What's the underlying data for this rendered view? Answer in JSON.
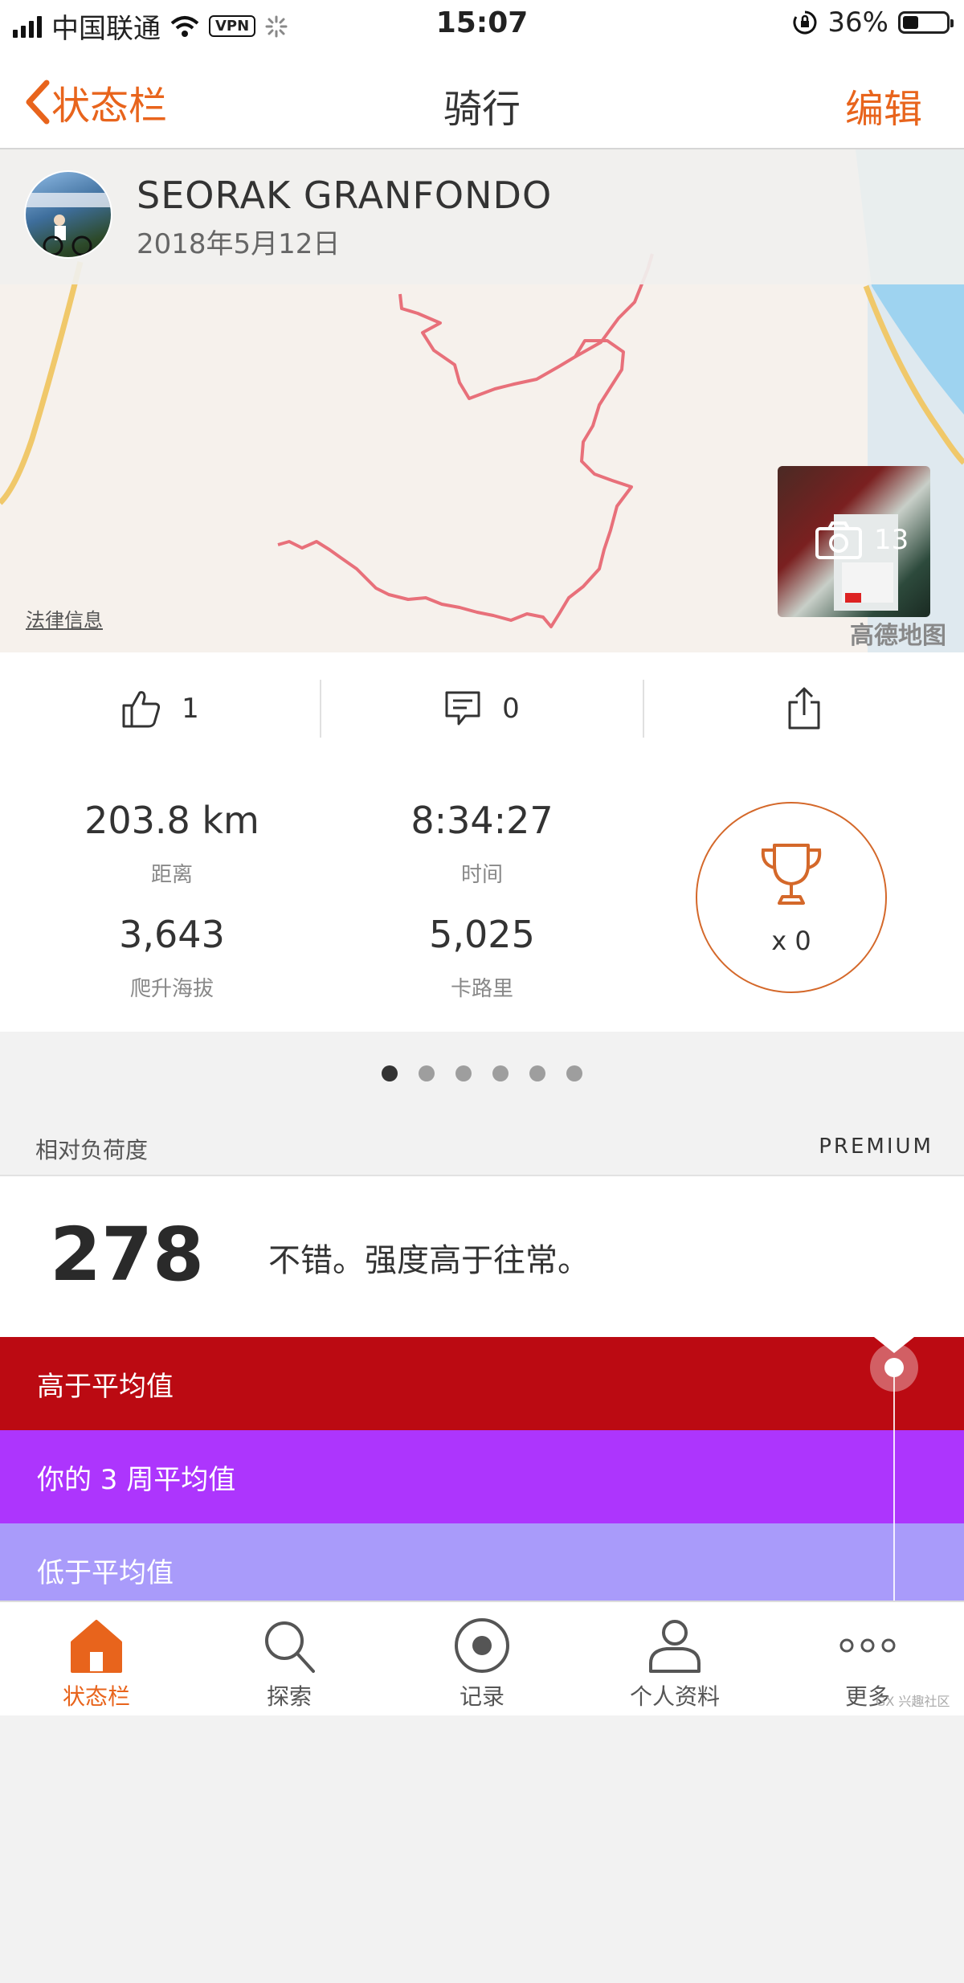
{
  "status_bar": {
    "carrier": "中国联通",
    "vpn": "VPN",
    "time": "15:07",
    "battery": "36%",
    "battery_level": 0.36
  },
  "nav": {
    "back_label": "状态栏",
    "title": "骑行",
    "edit_label": "编辑"
  },
  "activity": {
    "name": "SEORAK GRANFONDO",
    "date": "2018年5月12日",
    "photo_count": "13",
    "map_legal": "法律信息",
    "map_provider": "高德地图"
  },
  "actions": {
    "kudos_count": "1",
    "comment_count": "0"
  },
  "stats": [
    {
      "value": "203.8 km",
      "label": "距离"
    },
    {
      "value": "8:34:27",
      "label": "时间"
    },
    {
      "value": "3,643",
      "label": "爬升海拔"
    },
    {
      "value": "5,025",
      "label": "卡路里"
    }
  ],
  "achievements": {
    "count": "x 0"
  },
  "pager": {
    "total": 6,
    "active": 0
  },
  "relative_effort": {
    "section_title": "相对负荷度",
    "badge": "PREMIUM",
    "score": "278",
    "description": "不错。强度高于往常。",
    "bands": {
      "high": "高于平均值",
      "average": "你的 3 周平均值",
      "low": "低于平均值"
    }
  },
  "tabbar": {
    "items": [
      {
        "label": "状态栏",
        "icon": "home-icon",
        "active": true
      },
      {
        "label": "探索",
        "icon": "search-icon",
        "active": false
      },
      {
        "label": "记录",
        "icon": "record-icon",
        "active": false
      },
      {
        "label": "个人资料",
        "icon": "profile-icon",
        "active": false
      },
      {
        "label": "更多",
        "icon": "more-icon",
        "active": false
      }
    ]
  },
  "watermark": "GX 兴趣社区",
  "colors": {
    "accent": "#e8641c",
    "band_high": "#bb0a12",
    "band_average": "#ad35fd",
    "band_low": "#a99bfa",
    "route": "#e8707a"
  }
}
